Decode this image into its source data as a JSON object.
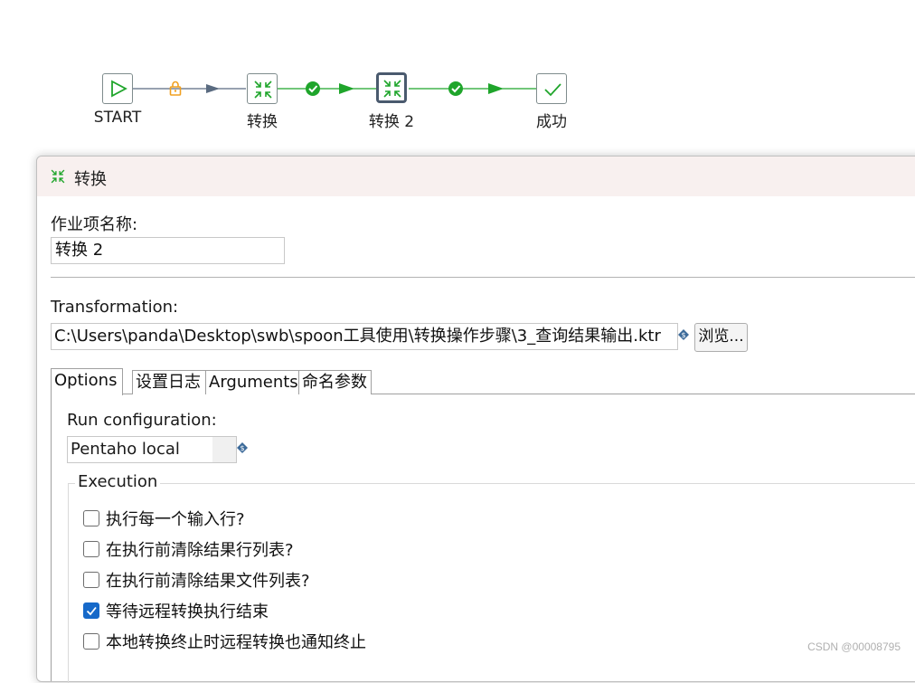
{
  "workflow": {
    "nodes": [
      {
        "id": "start",
        "label": "START",
        "icon": "play-icon",
        "selected": false
      },
      {
        "id": "transform1",
        "label": "转换",
        "icon": "transformation-icon",
        "selected": false
      },
      {
        "id": "transform2",
        "label": "转换 2",
        "icon": "transformation-icon",
        "selected": true
      },
      {
        "id": "success",
        "label": "成功",
        "icon": "checkmark-icon",
        "selected": false
      }
    ],
    "hops": [
      {
        "from": "start",
        "to": "transform1",
        "marker": "lock-icon",
        "color": "#5a6b80"
      },
      {
        "from": "transform1",
        "to": "transform2",
        "marker": "success-hop-icon",
        "color": "#1fa52b"
      },
      {
        "from": "transform2",
        "to": "success",
        "marker": "success-hop-icon",
        "color": "#1fa52b"
      }
    ],
    "colors": {
      "accent_green": "#1fa52b",
      "lock_orange": "#f0a020",
      "arrow_slate": "#5a6b80"
    }
  },
  "dialog": {
    "title": "转换",
    "title_icon": "transformation-icon",
    "entry_name_label": "作业项名称:",
    "entry_name_value": "转换 2",
    "transformation_label": "Transformation:",
    "transformation_path": "C:\\Users\\panda\\Desktop\\swb\\spoon工具使用\\转换操作步骤\\3_查询结果输出.ktr",
    "browse_button": "浏览...",
    "tabs": [
      {
        "label": "Options",
        "active": true
      },
      {
        "label": "设置日志",
        "active": false
      },
      {
        "label": "Arguments",
        "active": false
      },
      {
        "label": "命名参数",
        "active": false
      }
    ],
    "options": {
      "run_config_label": "Run configuration:",
      "run_config_value": "Pentaho local",
      "execution_group_label": "Execution",
      "checkboxes": [
        {
          "label": "执行每一个输入行?",
          "checked": false
        },
        {
          "label": "在执行前清除结果行列表?",
          "checked": false
        },
        {
          "label": "在执行前清除结果文件列表?",
          "checked": false
        },
        {
          "label": "等待远程转换执行结束",
          "checked": true
        },
        {
          "label": "本地转换终止时远程转换也通知终止",
          "checked": false
        }
      ]
    },
    "checkbox_color": "#1669c9"
  },
  "watermark": "CSDN @00008795"
}
